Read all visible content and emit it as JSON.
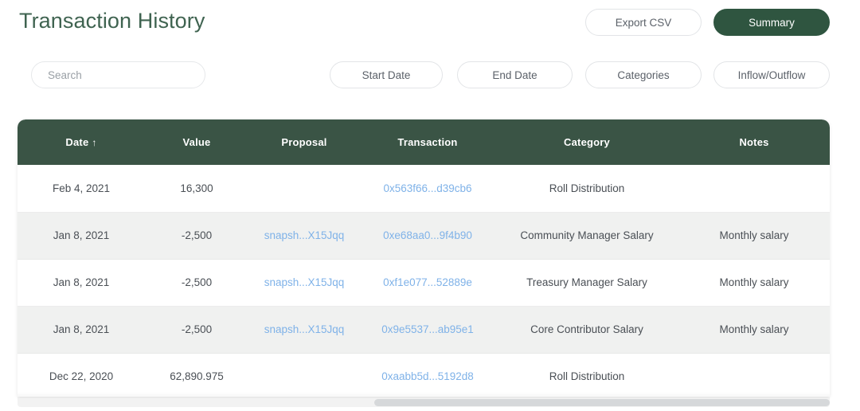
{
  "header": {
    "title": "Transaction History",
    "title_color": "#3f6350",
    "buttons": [
      {
        "label": "Export CSV",
        "style": "outline"
      },
      {
        "label": "Summary",
        "style": "solid"
      }
    ]
  },
  "filters": {
    "search": {
      "placeholder": "Search",
      "value": ""
    },
    "buttons": [
      {
        "label": "Start Date"
      },
      {
        "label": "End Date"
      },
      {
        "label": "Categories"
      },
      {
        "label": "Inflow/Outflow"
      }
    ]
  },
  "table": {
    "header_bg": "#3a5445",
    "accent": "#2f5540",
    "link_color": "#7fb2e8",
    "sort": {
      "column": "Date",
      "direction": "asc",
      "glyph": "↑"
    },
    "columns": [
      {
        "key": "date",
        "label": "Date"
      },
      {
        "key": "value",
        "label": "Value"
      },
      {
        "key": "proposal",
        "label": "Proposal"
      },
      {
        "key": "transaction",
        "label": "Transaction"
      },
      {
        "key": "category",
        "label": "Category"
      },
      {
        "key": "notes",
        "label": "Notes"
      }
    ],
    "rows": [
      {
        "date": "Feb 4, 2021",
        "value": "16,300",
        "proposal": "",
        "transaction": "0x563f66...d39cb6",
        "category": "Roll Distribution",
        "notes": ""
      },
      {
        "date": "Jan 8, 2021",
        "value": "-2,500",
        "proposal": "snapsh...X15Jqq",
        "transaction": "0xe68aa0...9f4b90",
        "category": "Community Manager Salary",
        "notes": "Monthly salary"
      },
      {
        "date": "Jan 8, 2021",
        "value": "-2,500",
        "proposal": "snapsh...X15Jqq",
        "transaction": "0xf1e077...52889e",
        "category": "Treasury Manager Salary",
        "notes": "Monthly salary"
      },
      {
        "date": "Jan 8, 2021",
        "value": "-2,500",
        "proposal": "snapsh...X15Jqq",
        "transaction": "0x9e5537...ab95e1",
        "category": "Core Contributor Salary",
        "notes": "Monthly salary"
      },
      {
        "date": "Dec 22, 2020",
        "value": "62,890.975",
        "proposal": "",
        "transaction": "0xaabb5d...5192d8",
        "category": "Roll Distribution",
        "notes": ""
      }
    ]
  }
}
